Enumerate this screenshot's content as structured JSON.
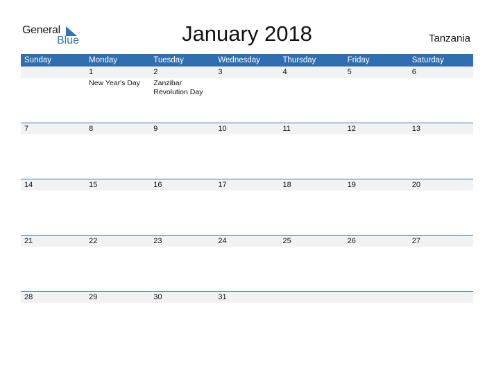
{
  "logo": {
    "general": "General",
    "blue": "Blue"
  },
  "title": "January 2018",
  "country": "Tanzania",
  "colors": {
    "accent": "#2f6fb0",
    "date_strip": "#f2f2f2"
  },
  "weekdays": [
    "Sunday",
    "Monday",
    "Tuesday",
    "Wednesday",
    "Thursday",
    "Friday",
    "Saturday"
  ],
  "weeks": [
    {
      "days": [
        "",
        "1",
        "2",
        "3",
        "4",
        "5",
        "6"
      ],
      "events": [
        "",
        "New Year's Day",
        "Zanzibar Revolution Day",
        "",
        "",
        "",
        ""
      ]
    },
    {
      "days": [
        "7",
        "8",
        "9",
        "10",
        "11",
        "12",
        "13"
      ],
      "events": [
        "",
        "",
        "",
        "",
        "",
        "",
        ""
      ]
    },
    {
      "days": [
        "14",
        "15",
        "16",
        "17",
        "18",
        "19",
        "20"
      ],
      "events": [
        "",
        "",
        "",
        "",
        "",
        "",
        ""
      ]
    },
    {
      "days": [
        "21",
        "22",
        "23",
        "24",
        "25",
        "26",
        "27"
      ],
      "events": [
        "",
        "",
        "",
        "",
        "",
        "",
        ""
      ]
    },
    {
      "days": [
        "28",
        "29",
        "30",
        "31",
        "",
        "",
        ""
      ],
      "events": [
        "",
        "",
        "",
        "",
        "",
        "",
        ""
      ]
    }
  ]
}
